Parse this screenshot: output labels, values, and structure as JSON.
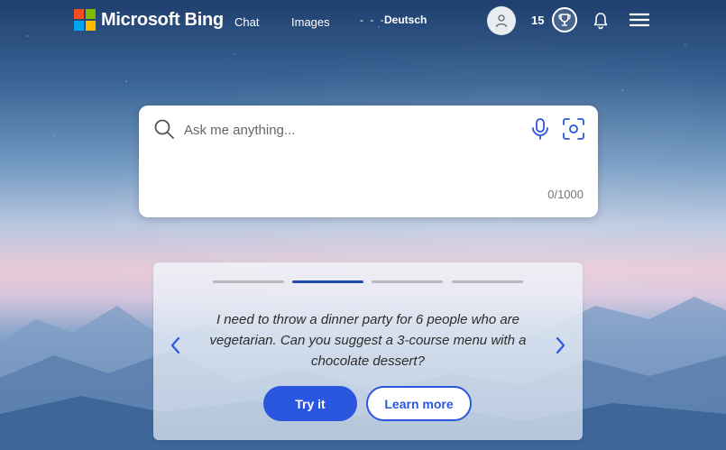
{
  "header": {
    "brand": "Microsoft Bing",
    "nav": [
      {
        "label": "Chat"
      },
      {
        "label": "Images"
      }
    ],
    "more_dots": "- - -",
    "language": "Deutsch",
    "rewards_points": "15"
  },
  "search": {
    "placeholder": "Ask me anything...",
    "value": "",
    "char_count": "0/1000"
  },
  "carousel": {
    "active_index": 1,
    "total": 4,
    "prompt": "I need to throw a dinner party for 6 people who are vegetarian. Can you suggest a 3-course menu with a chocolate dessert?",
    "try_label": "Try it",
    "learn_label": "Learn more"
  },
  "colors": {
    "accent": "#2a56e0",
    "indicator_active": "#1e4aa8",
    "ms_red": "#f25022",
    "ms_green": "#7fba00",
    "ms_blue": "#00a4ef",
    "ms_yellow": "#ffb900"
  },
  "icons": [
    "search-icon",
    "microphone-icon",
    "visual-search-icon",
    "user-icon",
    "trophy-icon",
    "bell-icon",
    "hamburger-menu-icon",
    "chevron-left-icon",
    "chevron-right-icon"
  ]
}
